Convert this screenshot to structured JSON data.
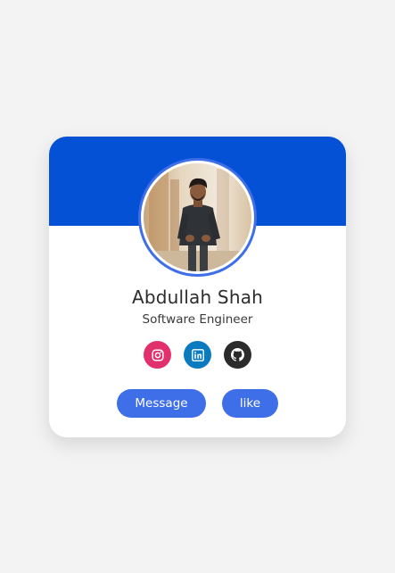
{
  "profile": {
    "name": "Abdullah Shah",
    "role": "Software Engineer",
    "avatar_icon": "profile-photo"
  },
  "socials": [
    {
      "icon": "instagram-icon",
      "color": "#e1306c"
    },
    {
      "icon": "linkedin-icon",
      "color": "#0a7bbf"
    },
    {
      "icon": "github-icon",
      "color": "#2b2b2b"
    }
  ],
  "buttons": {
    "message_label": "Message",
    "like_label": "like"
  },
  "colors": {
    "banner": "#0451d6",
    "accent": "#3e6fe8",
    "background": "#f3f3f3",
    "card": "#ffffff"
  }
}
